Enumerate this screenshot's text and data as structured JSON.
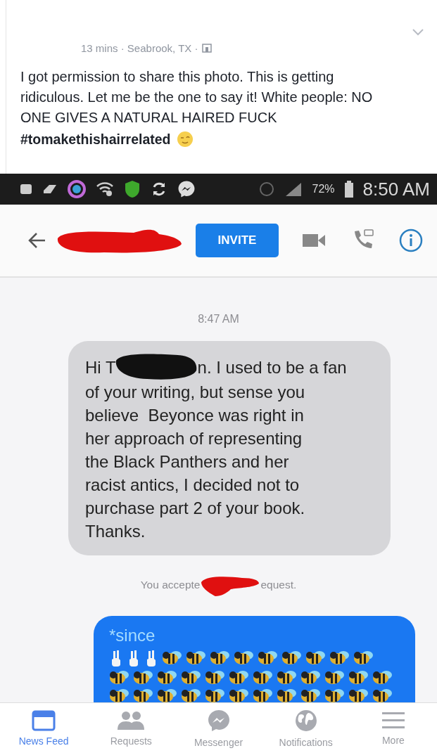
{
  "post": {
    "meta": "13 mins · Seabrook, TX ·",
    "text": "I got permission to share this photo. This is getting ridiculous. Let me be the one to say it! White people: NO ONE GIVES A NATURAL HAIRED FUCK",
    "hashtag": "#tomakethishairrelated"
  },
  "status_bar": {
    "battery": "72%",
    "time": "8:50 AM"
  },
  "chat_header": {
    "button": "INVITE"
  },
  "chat": {
    "timestamp": "8:47 AM",
    "message": {
      "before": "Hi T",
      "after": "n. I used to be a fan",
      "lines": [
        "of your writing, but sense you",
        "believe  Beyonce was right in",
        "her approach of representing",
        "the Black Panthers and her",
        "racist antics, I decided not to",
        "purchase part 2 of your book.",
        "Thanks."
      ]
    },
    "notice": {
      "before": "You accepte",
      "after": "equest."
    },
    "reply": {
      "text": "*since"
    }
  },
  "tabs": [
    {
      "label": "News Feed",
      "kind": "feed",
      "selected": true
    },
    {
      "label": "Requests",
      "kind": "requests",
      "selected": false
    },
    {
      "label": "Messenger",
      "kind": "messenger",
      "selected": false
    },
    {
      "label": "Notifications",
      "kind": "globe",
      "selected": false
    },
    {
      "label": "More",
      "kind": "menu",
      "selected": false
    }
  ]
}
